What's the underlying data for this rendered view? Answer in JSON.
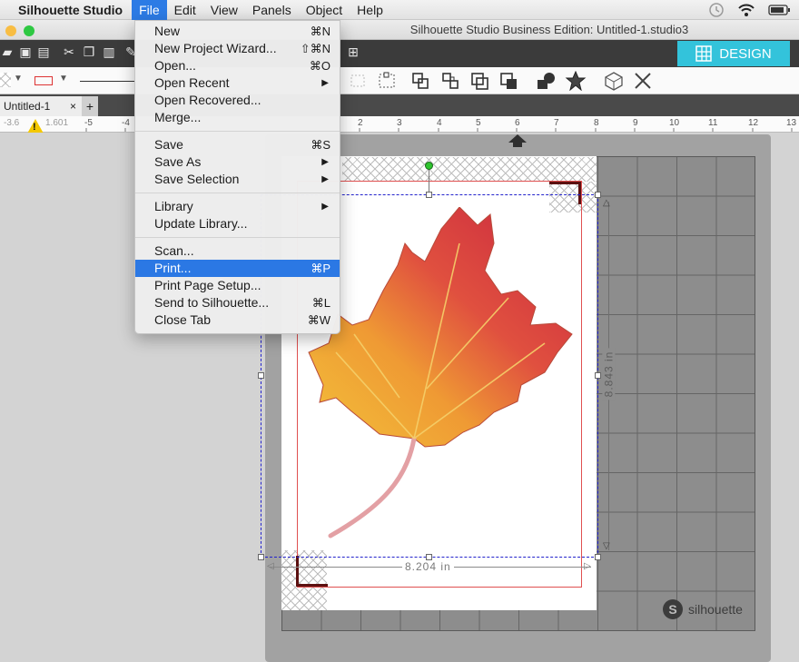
{
  "menubar": {
    "app_name": "Silhouette Studio",
    "items": [
      "File",
      "Edit",
      "View",
      "Panels",
      "Object",
      "Help"
    ]
  },
  "window": {
    "title": "Silhouette Studio Business Edition: Untitled-1.studio3"
  },
  "design_button": {
    "label": "DESIGN"
  },
  "tabs": {
    "document": "Untitled-1",
    "close": "×",
    "add": "+"
  },
  "ruler": {
    "left_fields": [
      "-3.6",
      "1.601"
    ],
    "labels": [
      "-5",
      "-4",
      "2",
      "3",
      "4",
      "5",
      "6",
      "7",
      "8",
      "9",
      "10",
      "11",
      "12",
      "13"
    ]
  },
  "dimensions": {
    "width": "8.204 in",
    "height": "8.843 in"
  },
  "mat": {
    "brand": "silhouette",
    "logo_letter": "S"
  },
  "file_menu": {
    "groups": [
      [
        {
          "label": "New",
          "shortcut": "⌘N"
        },
        {
          "label": "New Project Wizard...",
          "shortcut": "⇧⌘N"
        },
        {
          "label": "Open...",
          "shortcut": "⌘O"
        },
        {
          "label": "Open Recent",
          "submenu": true
        },
        {
          "label": "Open Recovered...",
          "shortcut": ""
        },
        {
          "label": "Merge...",
          "shortcut": ""
        }
      ],
      [
        {
          "label": "Save",
          "shortcut": "⌘S"
        },
        {
          "label": "Save As",
          "submenu": true
        },
        {
          "label": "Save Selection",
          "submenu": true
        }
      ],
      [
        {
          "label": "Library",
          "submenu": true
        },
        {
          "label": "Update Library...",
          "shortcut": ""
        }
      ],
      [
        {
          "label": "Scan...",
          "shortcut": ""
        },
        {
          "label": "Print...",
          "shortcut": "⌘P",
          "highlighted": true
        },
        {
          "label": "Print Page Setup...",
          "shortcut": ""
        },
        {
          "label": "Send to Silhouette...",
          "shortcut": "⌘L"
        },
        {
          "label": "Close Tab",
          "shortcut": "⌘W"
        }
      ]
    ]
  },
  "colors": {
    "menu_highlight": "#2b78e4",
    "design_button": "#33c3db",
    "cut_line": "#e05050",
    "selection": "#2222cc"
  }
}
